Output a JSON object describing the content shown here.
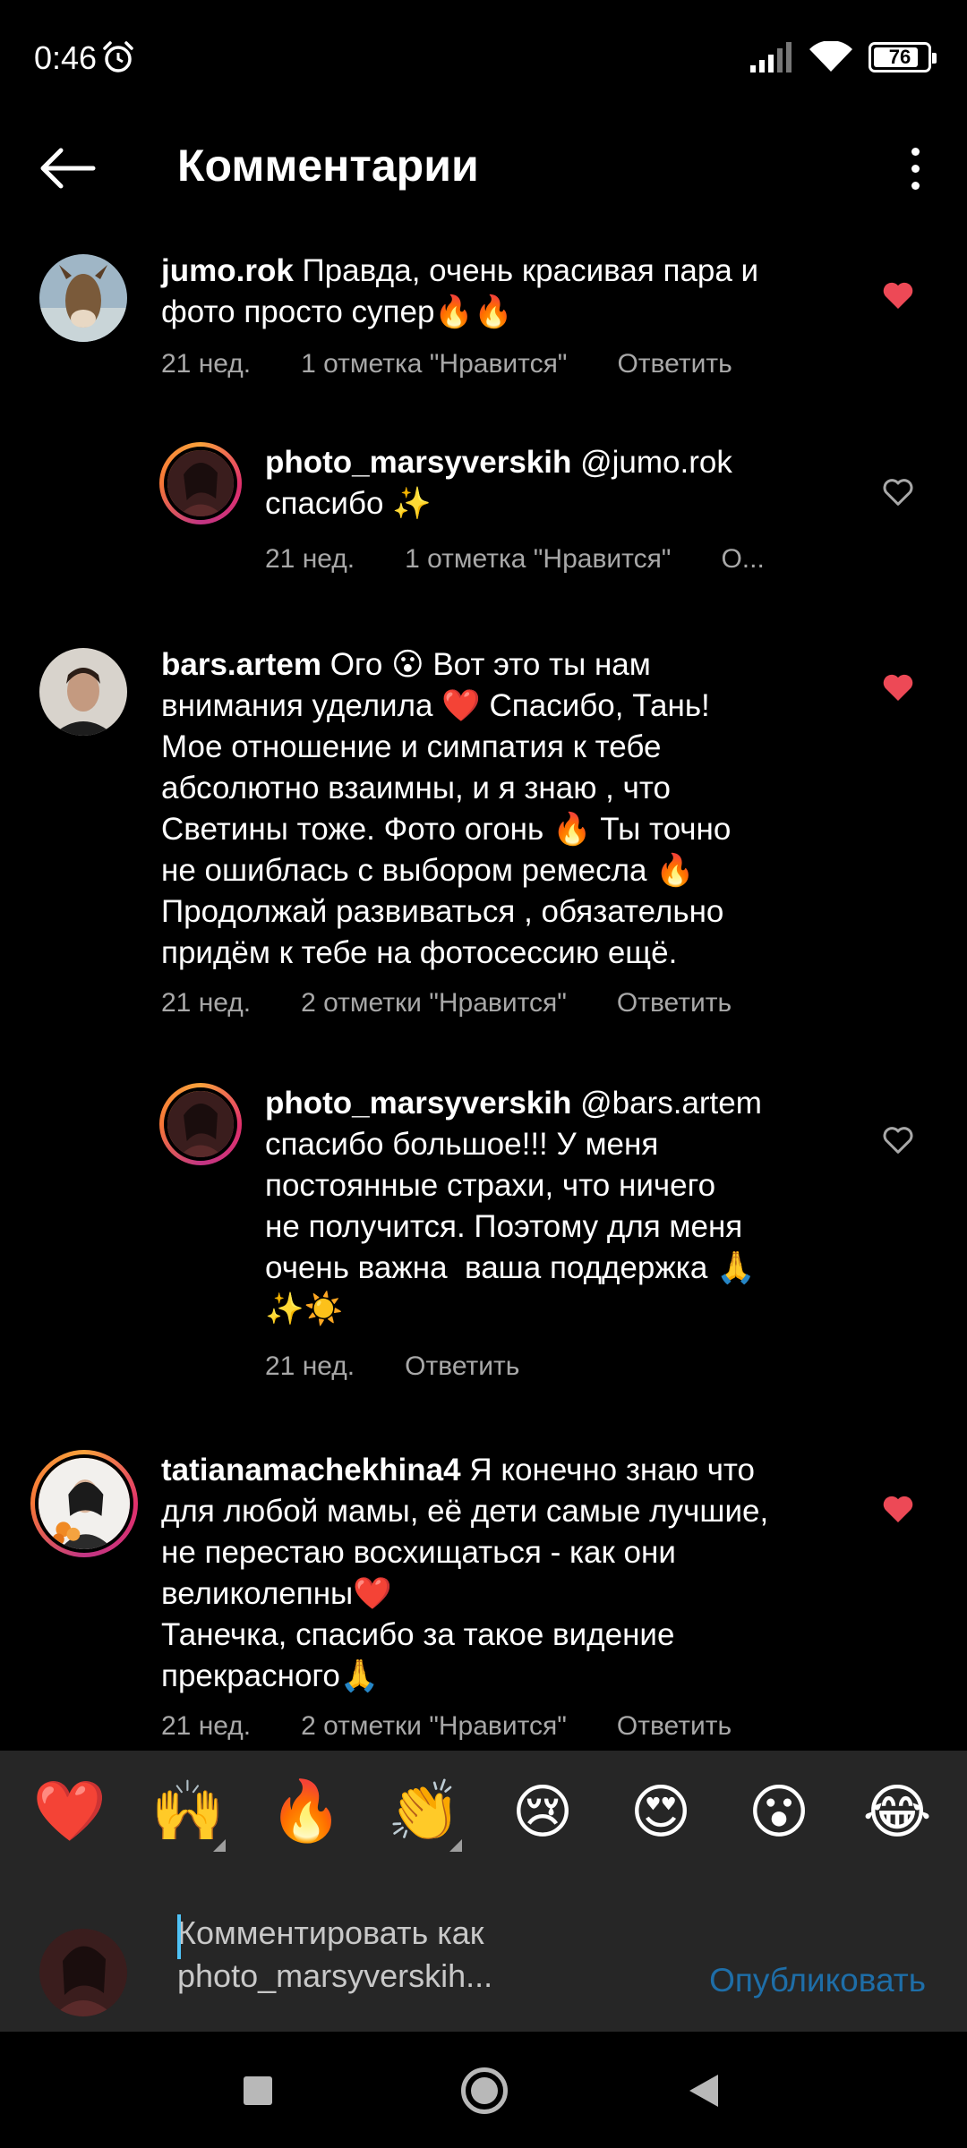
{
  "status_bar": {
    "time": "0:46",
    "battery": "76"
  },
  "header": {
    "title": "Комментарии"
  },
  "comments": [
    {
      "username": "jumo.rok",
      "text": " Правда, очень красивая пара и\nфото просто супер🔥🔥",
      "time": "21 нед.",
      "likes": "1 отметка \"Нравится\"",
      "reply": "Ответить",
      "liked": true
    },
    {
      "username": "photo_marsyverskih",
      "text": " @jumo.rok\nспасибо ✨",
      "time": "21 нед.",
      "likes": "1 отметка \"Нравится\"",
      "reply": "О...",
      "liked": false
    },
    {
      "username": "bars.artem",
      "text": " Ого 😮 Вот это ты нам\nвнимания уделила ❤️ Спасибо, Тань!\nМое отношение и симпатия к тебе\nабсолютно взаимны, и я знаю , что\nСветины тоже. Фото огонь 🔥 Ты точно\nне ошиблась с выбором ремесла 🔥\nПродолжай развиваться , обязательно\nпридём к тебе на фотосессию ещё.",
      "time": "21 нед.",
      "likes": "2 отметки \"Нравится\"",
      "reply": "Ответить",
      "liked": true
    },
    {
      "username": "photo_marsyverskih",
      "text": " @bars.artem\nспасибо большое!!! У меня\nпостоянные страхи, что ничего\nне получится. Поэтому для меня\nочень важна  ваша поддержка 🙏\n✨☀️",
      "time": "21 нед.",
      "reply": "Ответить",
      "liked": false
    },
    {
      "username": "tatianamachekhina4",
      "text": " Я конечно знаю что\nдля любой мамы, её дети самые лучшие,\nне перестаю восхищаться - как они\nвеликолепны❤️\nТанечка, спасибо за такое видение\nпрекрасного🙏",
      "time": "21 нед.",
      "likes": "2 отметки \"Нравится\"",
      "reply": "Ответить",
      "liked": true
    }
  ],
  "emoji_bar": [
    "❤️",
    "🙌",
    "🔥",
    "👏",
    "😢",
    "😍",
    "😮",
    "😂"
  ],
  "input": {
    "placeholder": "Комментировать как photo_marsyverskih...",
    "publish_label": "Опубликовать"
  },
  "colors": {
    "like_red": "#ed4956",
    "publish_blue": "#1e6ea8",
    "meta_gray": "#a8a8a8"
  }
}
